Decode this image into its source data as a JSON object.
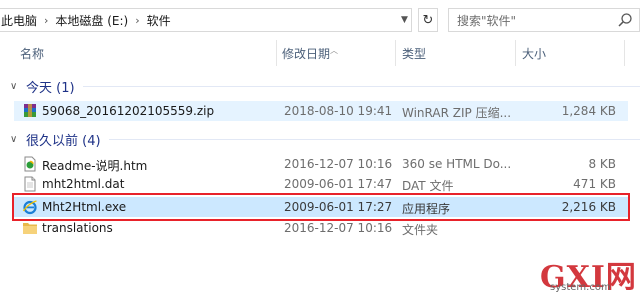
{
  "address": {
    "crumbs": [
      "此电脑",
      "本地磁盘 (E:)",
      "软件"
    ],
    "search_placeholder": "搜索\"软件\""
  },
  "columns": {
    "name": "名称",
    "date": "修改日期",
    "type": "类型",
    "size": "大小"
  },
  "groups": [
    {
      "label": "今天 (1)"
    },
    {
      "label": "很久以前 (4)"
    }
  ],
  "today_files": [
    {
      "name": "59068_20161202105559.zip",
      "date": "2018-08-10 19:41",
      "type": "WinRAR ZIP 压缩...",
      "size": "1,284 KB",
      "icon": "winrar-zip-icon"
    }
  ],
  "old_files": [
    {
      "name": "Readme-说明.htm",
      "date": "2016-12-07 10:16",
      "type": "360 se HTML Do...",
      "size": "8 KB",
      "icon": "html-document-icon"
    },
    {
      "name": "mht2html.dat",
      "date": "2009-06-01 17:47",
      "type": "DAT 文件",
      "size": "471 KB",
      "icon": "dat-file-icon"
    },
    {
      "name": "Mht2Html.exe",
      "date": "2009-06-01 17:27",
      "type": "应用程序",
      "size": "2,216 KB",
      "icon": "ie-application-icon"
    },
    {
      "name": "translations",
      "date": "2016-12-07 10:16",
      "type": "文件夹",
      "size": "",
      "icon": "folder-icon"
    }
  ],
  "watermark": {
    "big": "GXI网",
    "small": "system.com"
  },
  "colors": {
    "selected": "#cce8ff",
    "hover": "#e5f3ff",
    "highlight_border": "#e8222a",
    "group_text": "#1e3287"
  }
}
